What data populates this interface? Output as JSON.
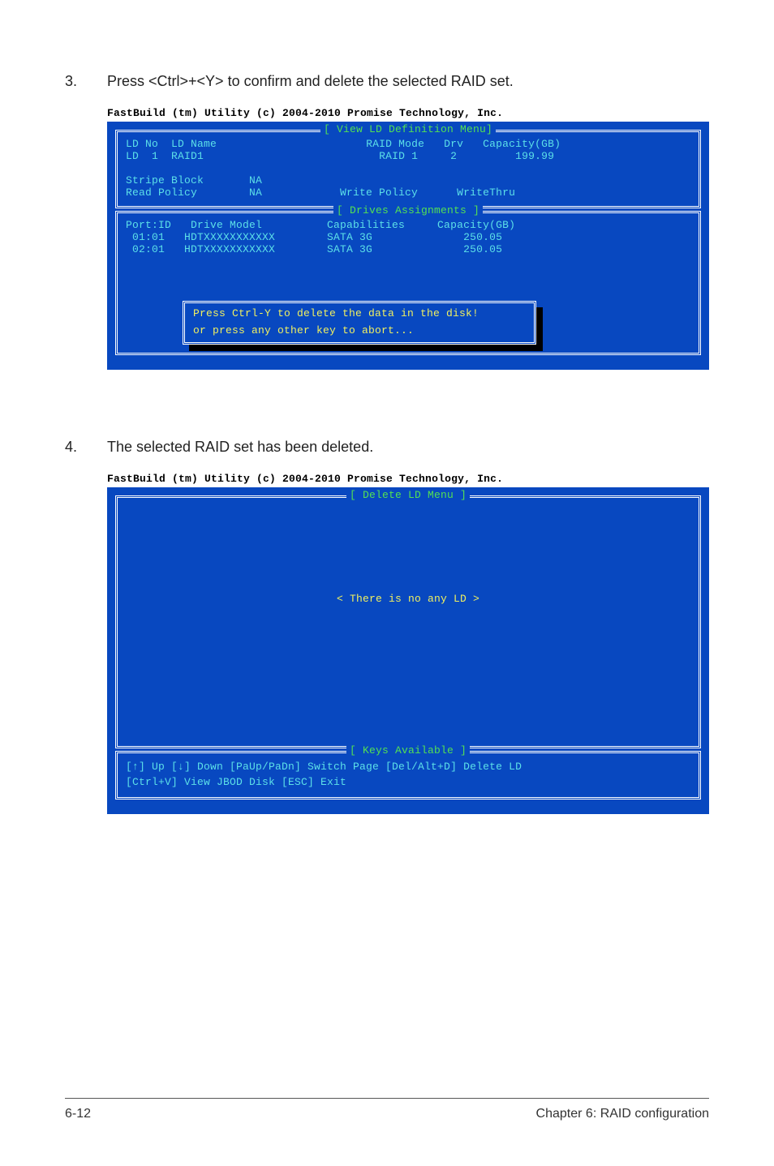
{
  "steps": {
    "s3": {
      "num": "3.",
      "text": "Press <Ctrl>+<Y> to confirm and delete the selected RAID set."
    },
    "s4": {
      "num": "4.",
      "text": "The selected RAID set has been deleted."
    }
  },
  "shot1": {
    "header": "FastBuild (tm) Utility (c) 2004-2010 Promise Technology, Inc.",
    "topTitle": "[ View LD Definition Menu]",
    "def": {
      "row1a": "LD No  LD Name",
      "row1b": "RAID Mode   Drv   Capacity(GB)",
      "row2a": "LD  1  RAID1",
      "row2b": "RAID 1     2         199.99",
      "row3a": "Stripe Block       NA",
      "row4a": "Read Policy        NA",
      "row4b": "Write Policy      WriteThru"
    },
    "drivesTitle": "[ Drives Assignments ]",
    "drives": {
      "h": "Port:ID   Drive Model          Capabilities     Capacity(GB)",
      "r1": " 01:01   HDTXXXXXXXXXXX        SATA 3G              250.05",
      "r2": " 02:01   HDTXXXXXXXXXXX        SATA 3G              250.05"
    },
    "dialog": {
      "l1": "Press Ctrl-Y to delete the data in the disk!",
      "l2": "or press any other key to abort..."
    }
  },
  "shot2": {
    "header": "FastBuild (tm) Utility (c) 2004-2010 Promise Technology, Inc.",
    "menuTitle": "[ Delete LD Menu ]",
    "empty": "< There is no any LD >",
    "keysTitle": "[ Keys Available ]",
    "keys1": "[↑] Up [↓] Down [PaUp/PaDn] Switch Page [Del/Alt+D] Delete LD",
    "keys2": "[Ctrl+V] View JBOD Disk  [ESC] Exit"
  },
  "footer": {
    "left": "6-12",
    "right": "Chapter 6: RAID configuration"
  }
}
